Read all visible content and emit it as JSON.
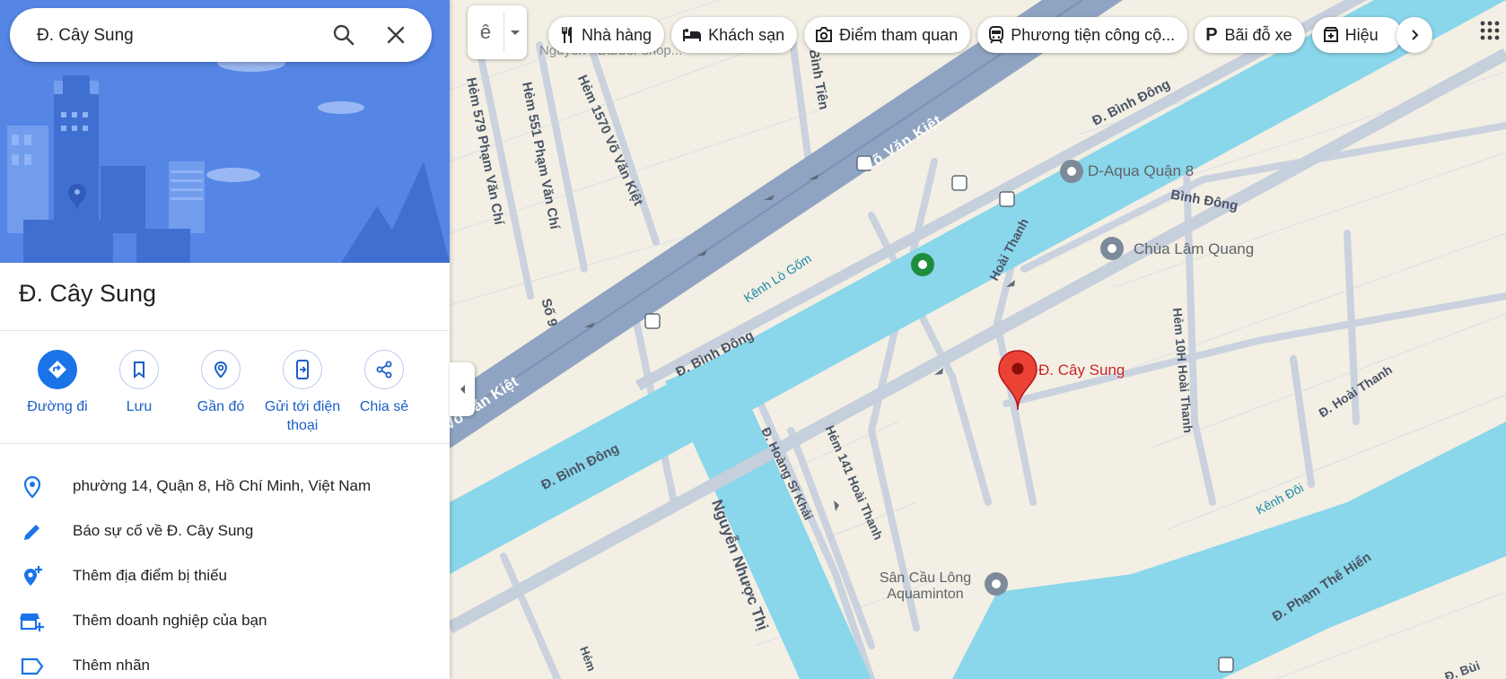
{
  "search": {
    "value": "Đ. Cây Sung",
    "search_icon": "search-icon",
    "clear_icon": "close-icon"
  },
  "place": {
    "title": "Đ. Cây Sung"
  },
  "actions": [
    {
      "label": "Đường đi",
      "icon": "directions-icon"
    },
    {
      "label": "Lưu",
      "icon": "bookmark-icon"
    },
    {
      "label": "Gần đó",
      "icon": "nearby-icon"
    },
    {
      "label": "Gửi tới điện thoại",
      "icon": "send-to-phone-icon"
    },
    {
      "label": "Chia sẻ",
      "icon": "share-icon"
    }
  ],
  "info": [
    {
      "text": "phường 14, Quận 8, Hồ Chí Minh, Việt Nam",
      "icon": "location-pin-icon"
    },
    {
      "text": "Báo sự cố về Đ. Cây Sung",
      "icon": "pencil-icon"
    },
    {
      "text": "Thêm địa điểm bị thiếu",
      "icon": "add-location-icon"
    },
    {
      "text": "Thêm doanh nghiệp của bạn",
      "icon": "add-business-icon"
    },
    {
      "text": "Thêm nhãn",
      "icon": "label-icon"
    }
  ],
  "chips": [
    {
      "label": "Nhà hàng",
      "icon": "restaurant-icon"
    },
    {
      "label": "Khách sạn",
      "icon": "hotel-icon"
    },
    {
      "label": "Điểm tham quan",
      "icon": "camera-icon"
    },
    {
      "label": "Phương tiện công cộ...",
      "icon": "transit-icon"
    },
    {
      "label": "Bãi đỗ xe",
      "icon": "parking-icon"
    },
    {
      "label": "Hiệu",
      "icon": "pharmacy-icon"
    }
  ],
  "layer_button": {
    "glyph": "ê"
  },
  "map": {
    "colors": {
      "land": "#f3efe4",
      "road": "#c6cfdc",
      "highway": "#8fa4c2",
      "water": "#8ad6ea",
      "pin": "#ea4335",
      "poi": "#7d8a9a",
      "park": "#1e8e3e"
    },
    "road_labels": [
      "Võ Văn Kiệt",
      "Võ Văn Kiệt",
      "Đ. Bình Đông",
      "Đ. Bình Đông",
      "Đ. Bình Đông",
      "Bình Đông",
      "Hẻm 579 Phạm Văn Chí",
      "Hẻm 551 Phạm Văn Chí",
      "Hẻm 1570 Võ Văn Kiệt",
      "Bình Tiên",
      "Số 9",
      "Hoài Thanh",
      "Đ. Hoàng Sĩ Khải",
      "Hẻm 141 Hoài Thanh",
      "Nguyễn Nhược Thị",
      "Hẻm 10H Hoài Thanh",
      "Đ. Hoài Thanh",
      "Đ. Phạm Thế Hiển",
      "Đ. Bùi Min",
      "Hẻm"
    ],
    "water_labels": [
      "Kênh Lò Gốm",
      "Kênh Đôi"
    ],
    "pois": [
      {
        "name": "D-Aqua Quận 8",
        "icon": "poi-icon"
      },
      {
        "name": "Chùa Lâm Quang",
        "icon": "temple-icon"
      },
      {
        "name": "Sân Cầu Lông Aquaminton",
        "icon": "poi-icon"
      },
      {
        "name": "Nguyễn - Barber shop...",
        "icon": "poi-icon"
      }
    ],
    "selected_pin": {
      "label": "Đ. Cây Sung"
    }
  }
}
